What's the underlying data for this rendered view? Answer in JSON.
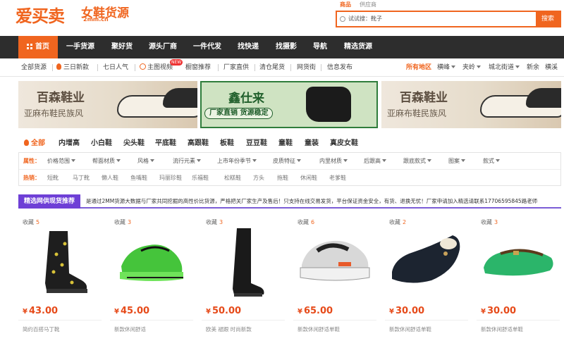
{
  "header": {
    "logo_main": "爱买卖",
    "logo_sub": "女鞋货源",
    "logo_url": "2mm.cn",
    "search_tabs": [
      "商品",
      "供应商"
    ],
    "search_value": "试试搜：靴子",
    "search_button": "搜索"
  },
  "nav": {
    "home": "首页",
    "items": [
      "一手货源",
      "聚好货",
      "源头厂商",
      "一件代发",
      "找快递",
      "找摄影",
      "导航",
      "精选货源"
    ]
  },
  "subnav": {
    "left": [
      "全部货源",
      "三日新款",
      "七日人气",
      "主图视频",
      "橱窗推荐",
      "厂家直供",
      "清仓尾货",
      "网货街",
      "信息发布"
    ],
    "new_badge": "NEW",
    "regions_title": "所有地区",
    "regions": [
      "横峰",
      "夹岭",
      "城北街道",
      "新余",
      "横溪"
    ]
  },
  "banners": {
    "a_title": "百森鞋业",
    "a_subtitle": "亚麻布鞋民族风",
    "b_title": "鑫仕来",
    "b_subtitle": "厂家直销  货源稳定"
  },
  "categories": [
    "全部",
    "内增高",
    "小白鞋",
    "尖头鞋",
    "平底鞋",
    "高跟鞋",
    "板鞋",
    "豆豆鞋",
    "童鞋",
    "童装",
    "真皮女鞋"
  ],
  "filters": {
    "attr_label": "属性：",
    "attrs": [
      "价格范围",
      "帮面材质",
      "风格",
      "流行元素",
      "上市年份季节",
      "皮质特征",
      "内里材质",
      "后跟高",
      "跟底款式",
      "图案",
      "款式"
    ],
    "hot_label": "热销：",
    "hot": [
      "短靴",
      "马丁靴",
      "懒人鞋",
      "鱼嘴鞋",
      "玛丽珍鞋",
      "乐福鞋",
      "松糕鞋",
      "方头",
      "拖鞋",
      "休闲鞋",
      "老爹鞋"
    ]
  },
  "promo": {
    "title": "精选网供现货推荐",
    "text": "是通过2MM货源大数据与厂家共同挖掘的高性价比货源，严格把关厂家生产及售后！只支持在线交易发货，平台保证资金安全，有货、退换无忧！厂家申请加入精选请联系17706595845路老师"
  },
  "products": [
    {
      "fav_label": "收藏",
      "fav": "5",
      "price": "43.00",
      "desc": "简约百搭马丁靴",
      "icon": "martin-boot"
    },
    {
      "fav_label": "收藏",
      "fav": "3",
      "price": "45.00",
      "desc": "新款休闲舒适",
      "icon": "green-sneaker"
    },
    {
      "fav_label": "收藏",
      "fav": "3",
      "price": "50.00",
      "desc": "欧美 褪跟 时尚新款",
      "icon": "tall-boot"
    },
    {
      "fav_label": "收藏",
      "fav": "6",
      "price": "65.00",
      "desc": "新款休闲舒适单鞋",
      "icon": "chunky-sneaker"
    },
    {
      "fav_label": "收藏",
      "fav": "2",
      "price": "30.00",
      "desc": "新款休闲舒适单鞋",
      "icon": "fur-loafer"
    },
    {
      "fav_label": "收藏",
      "fav": "3",
      "price": "30.00",
      "desc": "新款休闲舒适单鞋",
      "icon": "green-fur-shoe"
    }
  ],
  "colors": {
    "accent": "#f0651f",
    "nav_bg": "#2d2d2d",
    "promo": "#6e3fd6",
    "price": "#e64a19"
  }
}
